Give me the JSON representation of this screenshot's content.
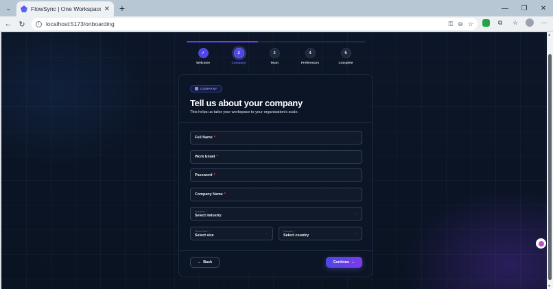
{
  "browser": {
    "tab_title": "FlowSync | One Workspace. Every",
    "url": "localhost:5173/onboarding",
    "tab_close": "✕",
    "new_tab": "+",
    "minimize": "—",
    "restore": "❐",
    "close": "✕"
  },
  "onboarding": {
    "progress_percent": 40,
    "steps": [
      {
        "label": "Welcome",
        "marker": "✓",
        "state": "done"
      },
      {
        "label": "Company",
        "marker": "2",
        "state": "active"
      },
      {
        "label": "Team",
        "marker": "3",
        "state": "pending"
      },
      {
        "label": "Preferences",
        "marker": "4",
        "state": "pending"
      },
      {
        "label": "Complete",
        "marker": "5",
        "state": "pending"
      }
    ]
  },
  "card": {
    "badge": "COMPANY",
    "title": "Tell us about your company",
    "subtitle": "This helps us tailor your workspace to your organisation's scale.",
    "required_mark": "*",
    "fields": {
      "full_name": "Full Name",
      "work_email": "Work Email",
      "password": "Password",
      "company_name": "Company Name"
    },
    "selects": {
      "industry_label": "Industry",
      "industry_value": "Select industry",
      "size_label": "Team Size",
      "size_value": "Select size",
      "country_label": "Country",
      "country_value": "Select country"
    },
    "back_label": "Back",
    "continue_label": "Continue"
  },
  "colors": {
    "accent": "#4f46e5",
    "accent_end": "#7c3aed",
    "background": "#0b1424",
    "required": "#ef4444"
  }
}
